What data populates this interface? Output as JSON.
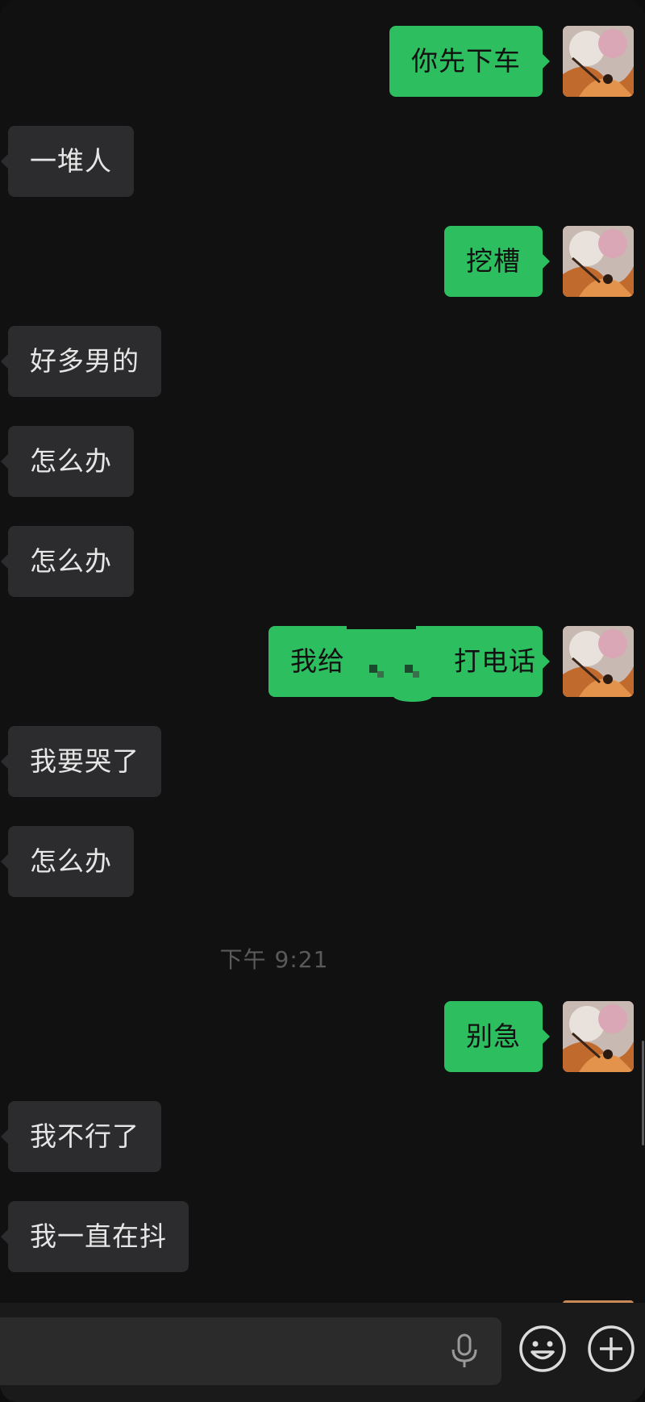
{
  "messages": [
    {
      "side": "out",
      "text": "你先下车"
    },
    {
      "side": "in",
      "text": "一堆人"
    },
    {
      "side": "out",
      "text": "挖槽"
    },
    {
      "side": "in",
      "text": "好多男的"
    },
    {
      "side": "in",
      "text": "怎么办"
    },
    {
      "side": "in",
      "text": "怎么办"
    },
    {
      "side": "out",
      "text_before": "我给",
      "text_after": "打电话",
      "redacted": true
    },
    {
      "side": "in",
      "text": "我要哭了"
    },
    {
      "side": "in",
      "text": "怎么办"
    },
    {
      "side": "out",
      "text": "别急"
    },
    {
      "side": "in",
      "text": "我不行了"
    },
    {
      "side": "in",
      "text": "我一直在抖"
    }
  ],
  "timestamp": "下午 9:21",
  "input_bar": {
    "icons": [
      "mic-icon",
      "emoji-icon",
      "plus-icon"
    ]
  },
  "colors": {
    "background": "#111112",
    "incoming_bubble": "#2c2c2e",
    "outgoing_bubble": "#2dbe5f",
    "timestamp_text": "#5a5a5c"
  }
}
